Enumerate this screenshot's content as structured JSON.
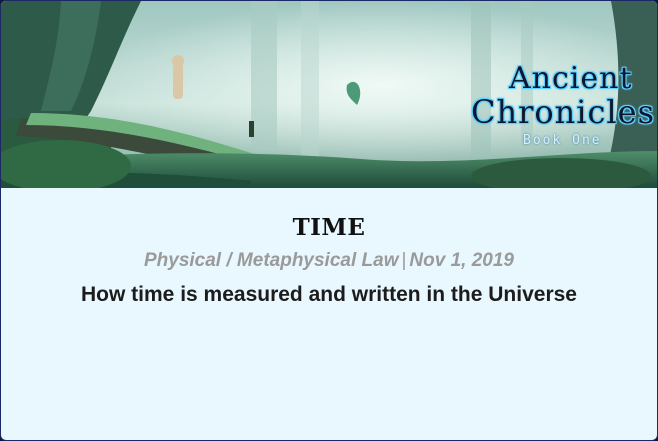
{
  "banner": {
    "logo": {
      "line1": "Ancient",
      "line2": "Chronicles",
      "subtitle": "Book One"
    }
  },
  "post": {
    "title": "TIME",
    "category": "Physical / Metaphysical Law",
    "separator": "|",
    "date": "Nov 1, 2019",
    "description": "How time is measured and written in the Universe"
  },
  "colors": {
    "card_background": "#e9f8fe",
    "border": "#1b2a66",
    "title": "#111111",
    "meta": "#9a9a9a",
    "logo_glow": "#5fd0ff"
  }
}
